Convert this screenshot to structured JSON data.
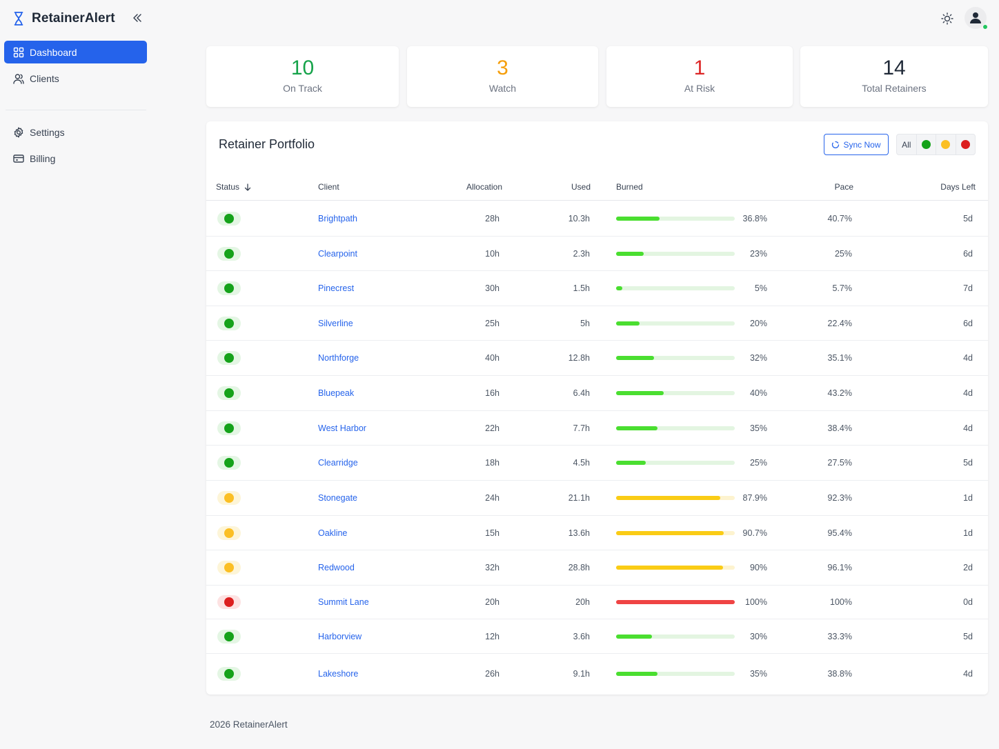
{
  "app": {
    "name": "RetainerAlert"
  },
  "nav": {
    "primary": [
      {
        "key": "dashboard",
        "label": "Dashboard",
        "icon": "grid-icon",
        "active": true
      },
      {
        "key": "clients",
        "label": "Clients",
        "icon": "users-icon",
        "active": false
      }
    ],
    "secondary": [
      {
        "key": "settings",
        "label": "Settings",
        "icon": "gear-icon"
      },
      {
        "key": "billing",
        "label": "Billing",
        "icon": "credit-card-icon"
      }
    ]
  },
  "stats": [
    {
      "key": "on-track",
      "value": "10",
      "label": "On Track",
      "color": "#16a34a"
    },
    {
      "key": "watch",
      "value": "3",
      "label": "Watch",
      "color": "#f59e0b"
    },
    {
      "key": "at-risk",
      "value": "1",
      "label": "At Risk",
      "color": "#dc2626"
    },
    {
      "key": "total",
      "value": "14",
      "label": "Total Retainers",
      "color": "#1f2937"
    }
  ],
  "portfolio": {
    "title": "Retainer Portfolio",
    "sync_label": "Sync Now",
    "filter_all_label": "All",
    "columns": {
      "status": "Status",
      "client": "Client",
      "allocation": "Allocation",
      "used": "Used",
      "burned": "Burned",
      "pace": "Pace",
      "days_left": "Days Left"
    },
    "rows": [
      {
        "status": "green",
        "client": "Brightpath",
        "allocation": "28h",
        "used": "10.3h",
        "burned_value": 36.8,
        "burned": "36.8%",
        "pace": "40.7%",
        "days_left": "5d"
      },
      {
        "status": "green",
        "client": "Clearpoint",
        "allocation": "10h",
        "used": "2.3h",
        "burned_value": 23,
        "burned": "23%",
        "pace": "25%",
        "days_left": "6d"
      },
      {
        "status": "green",
        "client": "Pinecrest",
        "allocation": "30h",
        "used": "1.5h",
        "burned_value": 5,
        "burned": "5%",
        "pace": "5.7%",
        "days_left": "7d"
      },
      {
        "status": "green",
        "client": "Silverline",
        "allocation": "25h",
        "used": "5h",
        "burned_value": 20,
        "burned": "20%",
        "pace": "22.4%",
        "days_left": "6d"
      },
      {
        "status": "green",
        "client": "Northforge",
        "allocation": "40h",
        "used": "12.8h",
        "burned_value": 32,
        "burned": "32%",
        "pace": "35.1%",
        "days_left": "4d"
      },
      {
        "status": "green",
        "client": "Bluepeak",
        "allocation": "16h",
        "used": "6.4h",
        "burned_value": 40,
        "burned": "40%",
        "pace": "43.2%",
        "days_left": "4d"
      },
      {
        "status": "green",
        "client": "West Harbor",
        "allocation": "22h",
        "used": "7.7h",
        "burned_value": 35,
        "burned": "35%",
        "pace": "38.4%",
        "days_left": "4d"
      },
      {
        "status": "green",
        "client": "Clearridge",
        "allocation": "18h",
        "used": "4.5h",
        "burned_value": 25,
        "burned": "25%",
        "pace": "27.5%",
        "days_left": "5d"
      },
      {
        "status": "yellow",
        "client": "Stonegate",
        "allocation": "24h",
        "used": "21.1h",
        "burned_value": 87.9,
        "burned": "87.9%",
        "pace": "92.3%",
        "days_left": "1d"
      },
      {
        "status": "yellow",
        "client": "Oakline",
        "allocation": "15h",
        "used": "13.6h",
        "burned_value": 90.7,
        "burned": "90.7%",
        "pace": "95.4%",
        "days_left": "1d"
      },
      {
        "status": "yellow",
        "client": "Redwood",
        "allocation": "32h",
        "used": "28.8h",
        "burned_value": 90,
        "burned": "90%",
        "pace": "96.1%",
        "days_left": "2d"
      },
      {
        "status": "red",
        "client": "Summit Lane",
        "allocation": "20h",
        "used": "20h",
        "burned_value": 100,
        "burned": "100%",
        "pace": "100%",
        "days_left": "0d"
      },
      {
        "status": "green",
        "client": "Harborview",
        "allocation": "12h",
        "used": "3.6h",
        "burned_value": 30,
        "burned": "30%",
        "pace": "33.3%",
        "days_left": "5d"
      },
      {
        "status": "green",
        "client": "Lakeshore",
        "allocation": "26h",
        "used": "9.1h",
        "burned_value": 35,
        "burned": "35%",
        "pace": "38.8%",
        "days_left": "4d"
      }
    ]
  },
  "status_colors": {
    "green": {
      "dot": "#15a21a",
      "pill": "#e4f6e4",
      "bar": "#4ade30",
      "track": "#e3f5e1"
    },
    "yellow": {
      "dot": "#fbbf24",
      "pill": "#fdf5d8",
      "bar": "#facc15",
      "track": "#fdf3cf"
    },
    "red": {
      "dot": "#dc1f1f",
      "pill": "#fde2e2",
      "bar": "#ef4444",
      "track": "#fde2e2"
    }
  },
  "accent_color": "#2563eb",
  "footer": {
    "text": "2026 RetainerAlert"
  }
}
